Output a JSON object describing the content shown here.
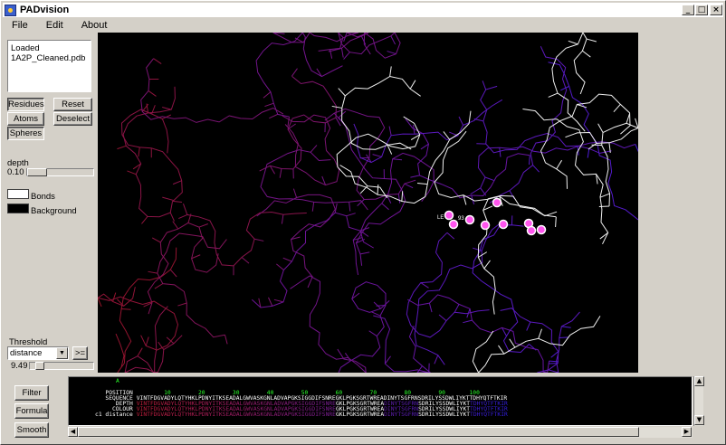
{
  "window": {
    "title": "PADvision",
    "minimize": "_",
    "maximize": "□",
    "close": "×"
  },
  "menu": {
    "file": "File",
    "edit": "Edit",
    "about": "About"
  },
  "loaded": {
    "line1": "Loaded",
    "line2": "1A2P_Cleaned.pdb"
  },
  "buttons": {
    "residues": "Residues",
    "reset": "Reset",
    "atoms": "Atoms",
    "deselect": "Deselect",
    "spheres": "Spheres",
    "filter": "Filter",
    "formula": "Formula",
    "smooth": "Smooth",
    "compare": ">="
  },
  "depth": {
    "label": "depth",
    "value": "0.10"
  },
  "bonds": {
    "label": "Bonds",
    "color": "#ffffff"
  },
  "background": {
    "label": "Background",
    "color": "#000000"
  },
  "threshold": {
    "label": "Threshold",
    "selected": "distance",
    "value": "9.49"
  },
  "viewer": {
    "residue_label": "LE",
    "residue_label2": "93"
  },
  "sequence": {
    "marker": "A",
    "positions": [
      "10",
      "20",
      "30",
      "40",
      "50",
      "60",
      "70",
      "80",
      "90",
      "100"
    ],
    "headers": [
      "POSITION",
      "SEQUENCE",
      "DEPTH",
      "COLOUR",
      "c1 distance"
    ],
    "seq1": "VINTFDGVADYLQTYHKLPDNYITKSEADALGWVASKGNLADVAPGKSIGGDIFSNREGKLPGKSGRTWREADINYTSGFRNSDRILYSSDWLIYKTTDHYQTFTKIR",
    "seq_tail": "LPGKSGRTWREADI"
  },
  "colors": {
    "accent_red": "#c0203a",
    "accent_purple": "#6a22c8",
    "white_model": "#ffffff",
    "sphere": "#ff55ee"
  }
}
